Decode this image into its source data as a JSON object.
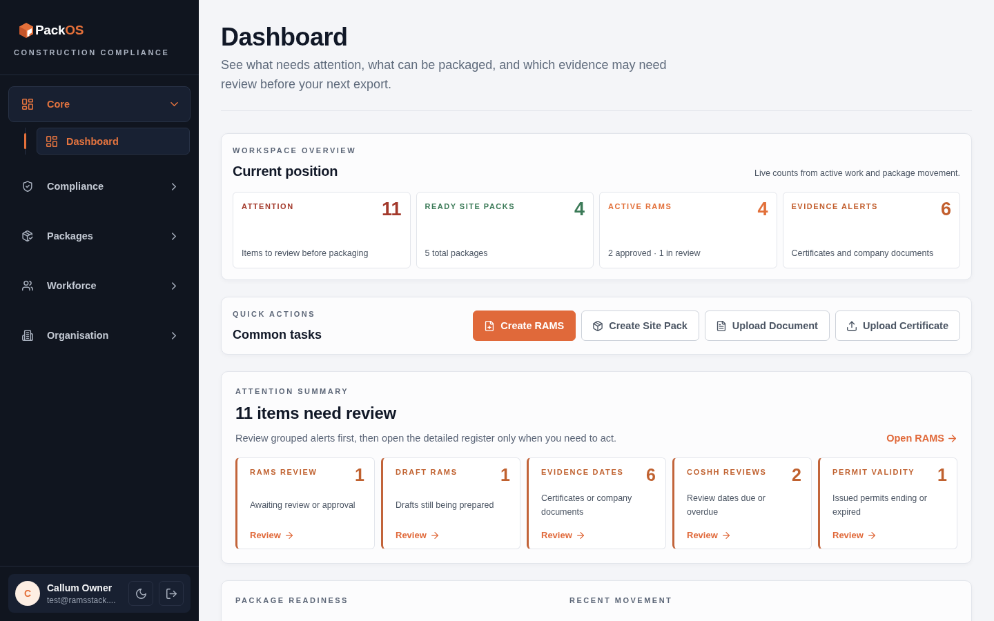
{
  "sidebar": {
    "brand": {
      "name": "Pack",
      "name_accent": "OS",
      "tagline": "CONSTRUCTION COMPLIANCE"
    },
    "nav": [
      {
        "label": "Core",
        "selected": true,
        "expanded": true,
        "children": [
          {
            "label": "Dashboard",
            "selected": true
          }
        ]
      },
      {
        "label": "Compliance",
        "selected": false,
        "expanded": false
      },
      {
        "label": "Packages",
        "selected": false,
        "expanded": false
      },
      {
        "label": "Workforce",
        "selected": false,
        "expanded": false
      },
      {
        "label": "Organisation",
        "selected": false,
        "expanded": false
      }
    ],
    "user": {
      "initial": "C",
      "name": "Callum Owner",
      "email": "test@ramsstack...."
    }
  },
  "header": {
    "title": "Dashboard",
    "subtitle": "See what needs attention, what can be packaged, and which evidence may need review before your next export."
  },
  "overview": {
    "eyebrow": "WORKSPACE OVERVIEW",
    "title": "Current position",
    "note": "Live counts from active work and package movement.",
    "stats": [
      {
        "label": "ATTENTION",
        "value": "11",
        "description": "Items to review before packaging",
        "color": "#a3392b"
      },
      {
        "label": "READY SITE PACKS",
        "value": "4",
        "description": "5 total packages",
        "color": "#3b7a57"
      },
      {
        "label": "ACTIVE RAMS",
        "value": "4",
        "description": "2 approved · 1 in review",
        "color": "#e2703a"
      },
      {
        "label": "EVIDENCE ALERTS",
        "value": "6",
        "description": "Certificates and company documents",
        "color": "#c25e2d"
      }
    ]
  },
  "quick_actions": {
    "eyebrow": "QUICK ACTIONS",
    "title": "Common tasks",
    "buttons": [
      {
        "label": "Create RAMS",
        "kind": "primary"
      },
      {
        "label": "Create Site Pack",
        "kind": "secondary"
      },
      {
        "label": "Upload Document",
        "kind": "secondary"
      },
      {
        "label": "Upload Certificate",
        "kind": "secondary"
      }
    ]
  },
  "attention_summary": {
    "eyebrow": "ATTENTION SUMMARY",
    "title": "11 items need review",
    "description": "Review grouped alerts first, then open the detailed register only when you need to act.",
    "link": "Open RAMS",
    "alerts": [
      {
        "label": "RAMS REVIEW",
        "count": "1",
        "description": "Awaiting review or approval",
        "action": "Review"
      },
      {
        "label": "DRAFT RAMS",
        "count": "1",
        "description": "Drafts still being prepared",
        "action": "Review"
      },
      {
        "label": "EVIDENCE DATES",
        "count": "6",
        "description": "Certificates or company documents",
        "action": "Review"
      },
      {
        "label": "COSHH REVIEWS",
        "count": "2",
        "description": "Review dates due or overdue",
        "action": "Review"
      },
      {
        "label": "PERMIT VALIDITY",
        "count": "1",
        "description": "Issued permits ending or expired",
        "action": "Review"
      }
    ]
  },
  "bottom_panels": [
    {
      "eyebrow": "PACKAGE READINESS"
    },
    {
      "eyebrow": "RECENT MOVEMENT"
    }
  ]
}
